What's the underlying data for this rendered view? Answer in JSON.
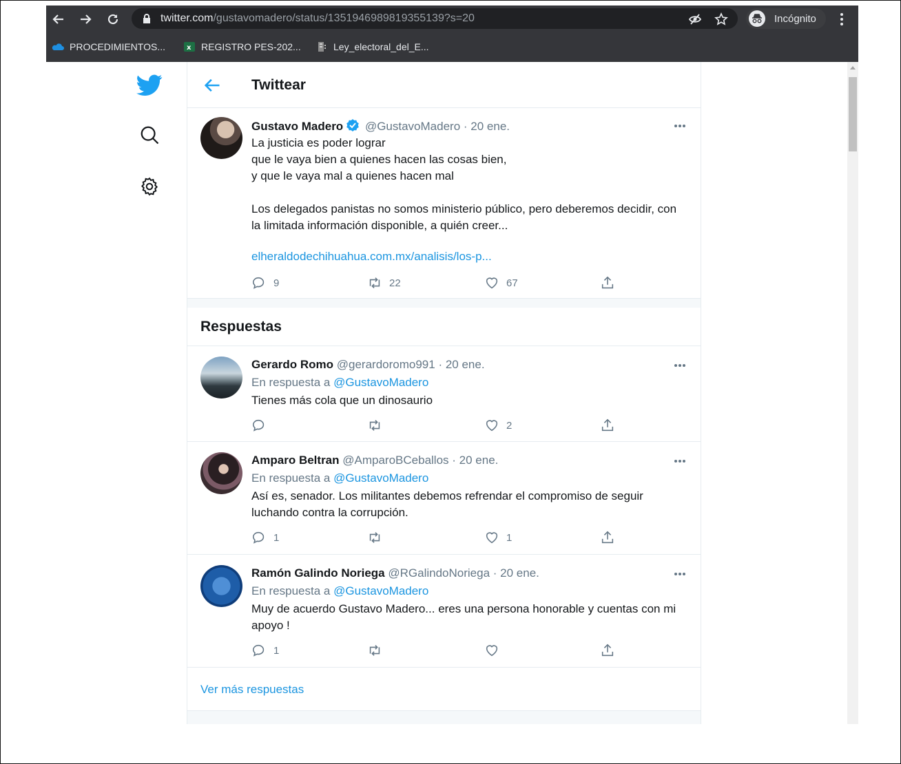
{
  "browser": {
    "url_host": "twitter.com",
    "url_path": "/gustavomadero/status/1351946989819355139?s=20",
    "incognito_label": "Incógnito",
    "bookmarks": [
      {
        "label": "PROCEDIMIENTOS...",
        "icon": "onedrive-icon"
      },
      {
        "label": "REGISTRO PES-202...",
        "icon": "excel-icon"
      },
      {
        "label": "Ley_electoral_del_E...",
        "icon": "document-icon"
      }
    ]
  },
  "page": {
    "header_title": "Twittear",
    "main_tweet": {
      "name": "Gustavo Madero",
      "handle": "@GustavoMadero",
      "date": "· 20 ene.",
      "lines": [
        "La justicia es poder lograr",
        "que le vaya bien a quienes hacen las cosas bien,",
        "y que le vaya mal a quienes hacen mal",
        "",
        "Los delegados panistas no somos ministerio público, pero deberemos decidir, con la limitada información disponible, a quién creer..."
      ],
      "link": "elheraldodechihuahua.com.mx/analisis/los-p...",
      "replies": "9",
      "retweets": "22",
      "likes": "67"
    },
    "replies_title": "Respuestas",
    "reply_prefix": "En respuesta a",
    "replies": [
      {
        "name": "Gerardo Romo",
        "handle": "@gerardoromo991",
        "date": "· 20 ene.",
        "mention": "@GustavoMadero",
        "text": "Tienes más cola que un dinosaurio",
        "replies": "",
        "retweets": "",
        "likes": "2"
      },
      {
        "name": "Amparo Beltran",
        "handle": "@AmparoBCeballos",
        "date": "· 20 ene.",
        "mention": "@GustavoMadero",
        "text": "Así es, senador. Los militantes debemos refrendar el compromiso de seguir luchando contra la corrupción.",
        "replies": "1",
        "retweets": "",
        "likes": "1"
      },
      {
        "name": "Ramón Galindo Noriega",
        "handle": "@RGalindoNoriega",
        "date": "· 20 ene.",
        "mention": "@GustavoMadero",
        "text": "Muy de acuerdo Gustavo Madero... eres una persona honorable y cuentas con mi apoyo !",
        "replies": "1",
        "retweets": "",
        "likes": ""
      }
    ],
    "more_replies": "Ver más respuestas"
  },
  "colors": {
    "chrome_bg": "#35363a",
    "twitter_blue": "#1da1f2",
    "link_blue": "#1b95e0",
    "muted_text": "#657786"
  }
}
